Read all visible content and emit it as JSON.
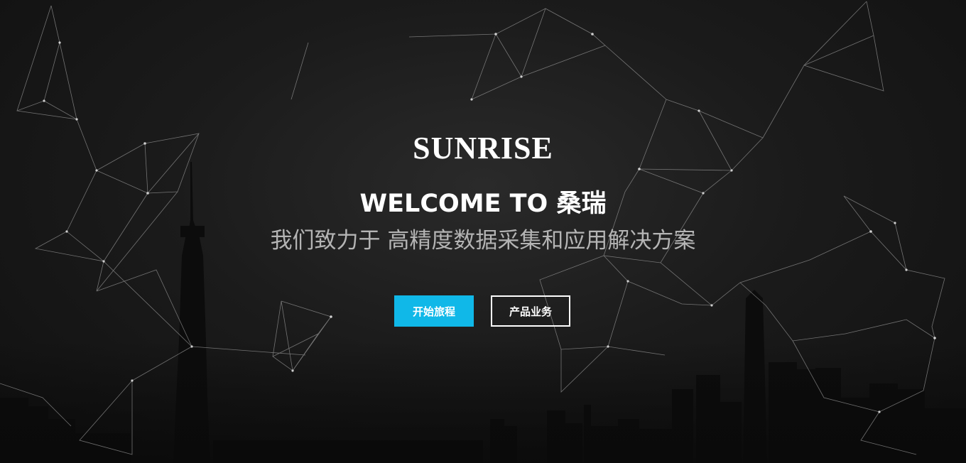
{
  "hero": {
    "logo": "SUNRISE",
    "welcome": "WELCOME TO 桑瑞",
    "subtitle": "我们致力于 高精度数据采集和应用解决方案",
    "buttons": {
      "start": "开始旅程",
      "products": "产品业务"
    }
  },
  "colors": {
    "accent": "#10b8e8",
    "background": "#1b1b1b",
    "subtitle_text": "#b4b4b4",
    "network_lines": "#9a9a9a"
  },
  "background_image": {
    "description_icon": "city-skyline-network"
  }
}
